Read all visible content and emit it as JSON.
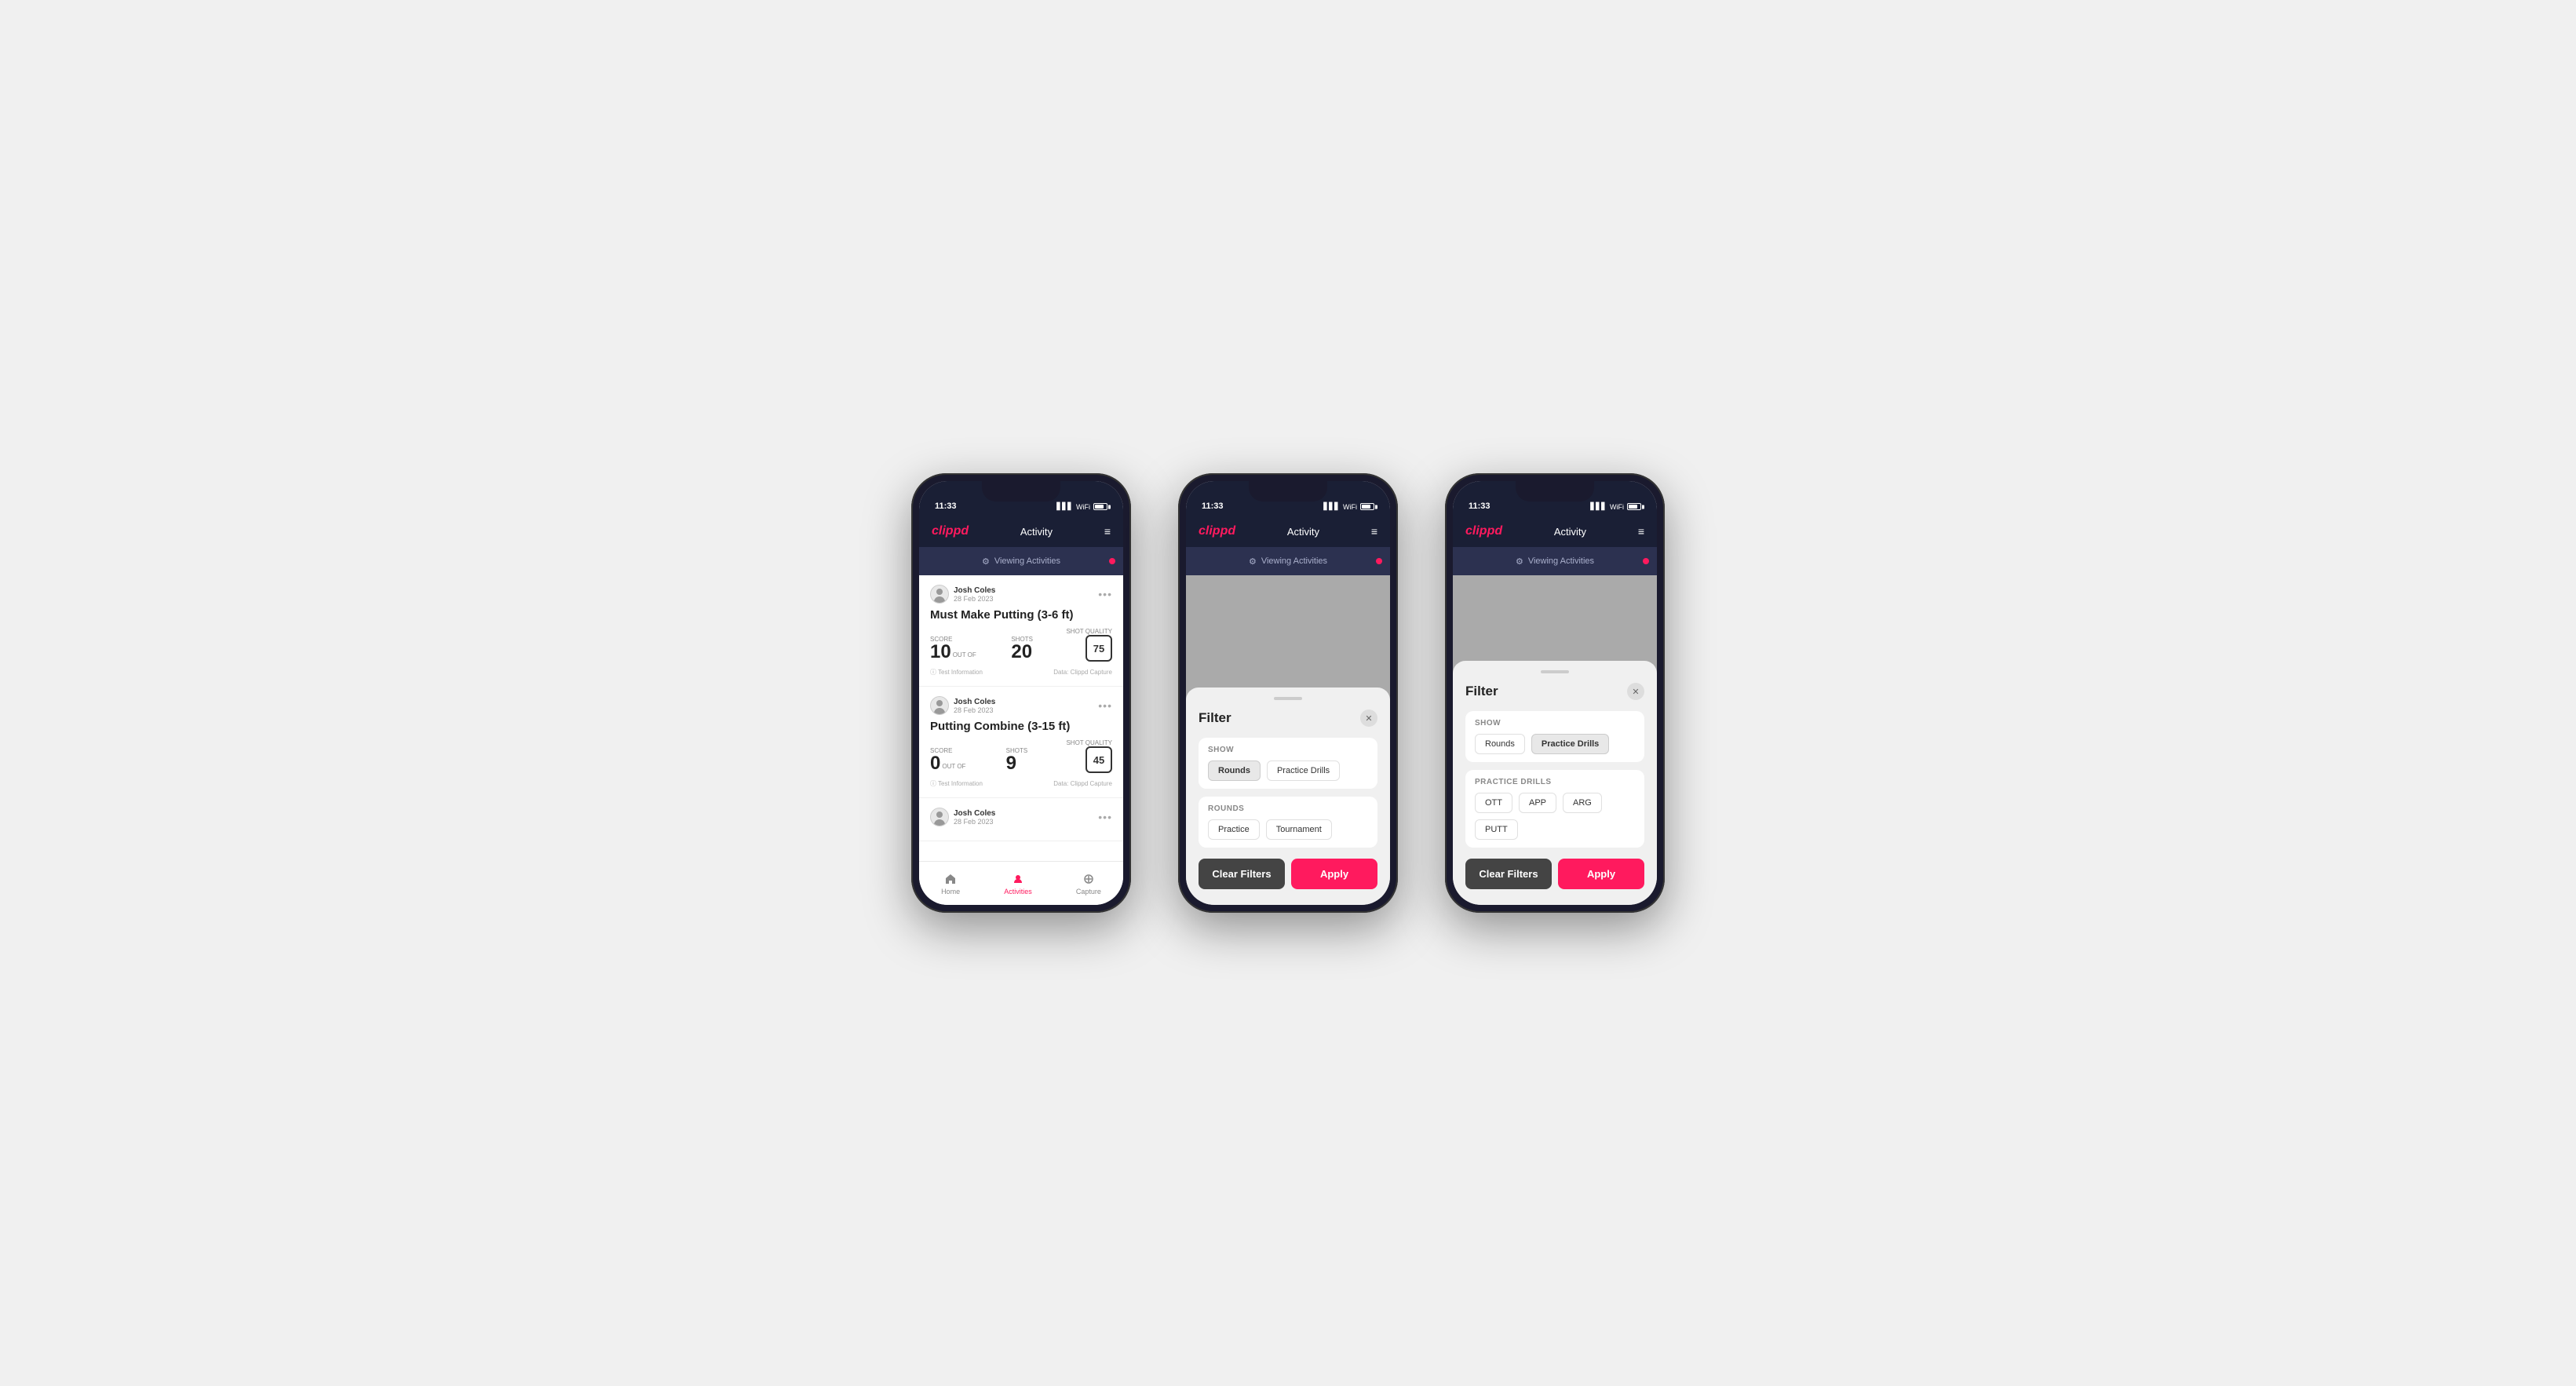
{
  "phones": [
    {
      "id": "phone1",
      "type": "main",
      "statusBar": {
        "time": "11:33",
        "battery": "31"
      },
      "nav": {
        "logo": "clippd",
        "title": "Activity",
        "menuIcon": "≡"
      },
      "viewingBar": {
        "text": "Viewing Activities"
      },
      "activities": [
        {
          "user": "Josh Coles",
          "date": "28 Feb 2023",
          "title": "Must Make Putting (3-6 ft)",
          "scoreLabel": "Score",
          "score": "10",
          "outOf": "OUT OF",
          "shots": "20",
          "shotsLabel": "Shots",
          "shotQualityLabel": "Shot Quality",
          "shotQuality": "75",
          "testInfo": "Test Information",
          "dataSource": "Data: Clippd Capture"
        },
        {
          "user": "Josh Coles",
          "date": "28 Feb 2023",
          "title": "Putting Combine (3-15 ft)",
          "scoreLabel": "Score",
          "score": "0",
          "outOf": "OUT OF",
          "shots": "9",
          "shotsLabel": "Shots",
          "shotQualityLabel": "Shot Quality",
          "shotQuality": "45",
          "testInfo": "Test Information",
          "dataSource": "Data: Clippd Capture"
        },
        {
          "user": "Josh Coles",
          "date": "28 Feb 2023",
          "title": "",
          "scoreLabel": "",
          "score": "",
          "outOf": "",
          "shots": "",
          "shotsLabel": "",
          "shotQualityLabel": "",
          "shotQuality": "",
          "testInfo": "",
          "dataSource": ""
        }
      ],
      "bottomNav": [
        {
          "label": "Home",
          "active": false,
          "icon": "home"
        },
        {
          "label": "Activities",
          "active": true,
          "icon": "activities"
        },
        {
          "label": "Capture",
          "active": false,
          "icon": "capture"
        }
      ]
    },
    {
      "id": "phone2",
      "type": "filter-rounds",
      "statusBar": {
        "time": "11:33",
        "battery": "31"
      },
      "nav": {
        "logo": "clippd",
        "title": "Activity",
        "menuIcon": "≡"
      },
      "viewingBar": {
        "text": "Viewing Activities"
      },
      "filter": {
        "title": "Filter",
        "showLabel": "Show",
        "showOptions": [
          {
            "label": "Rounds",
            "active": true
          },
          {
            "label": "Practice Drills",
            "active": false
          }
        ],
        "roundsLabel": "Rounds",
        "roundOptions": [
          {
            "label": "Practice",
            "active": false
          },
          {
            "label": "Tournament",
            "active": false
          }
        ],
        "clearLabel": "Clear Filters",
        "applyLabel": "Apply"
      }
    },
    {
      "id": "phone3",
      "type": "filter-drills",
      "statusBar": {
        "time": "11:33",
        "battery": "31"
      },
      "nav": {
        "logo": "clippd",
        "title": "Activity",
        "menuIcon": "≡"
      },
      "viewingBar": {
        "text": "Viewing Activities"
      },
      "filter": {
        "title": "Filter",
        "showLabel": "Show",
        "showOptions": [
          {
            "label": "Rounds",
            "active": false
          },
          {
            "label": "Practice Drills",
            "active": true
          }
        ],
        "drillsLabel": "Practice Drills",
        "drillOptions": [
          {
            "label": "OTT",
            "active": false
          },
          {
            "label": "APP",
            "active": false
          },
          {
            "label": "ARG",
            "active": false
          },
          {
            "label": "PUTT",
            "active": false
          }
        ],
        "clearLabel": "Clear Filters",
        "applyLabel": "Apply"
      }
    }
  ]
}
